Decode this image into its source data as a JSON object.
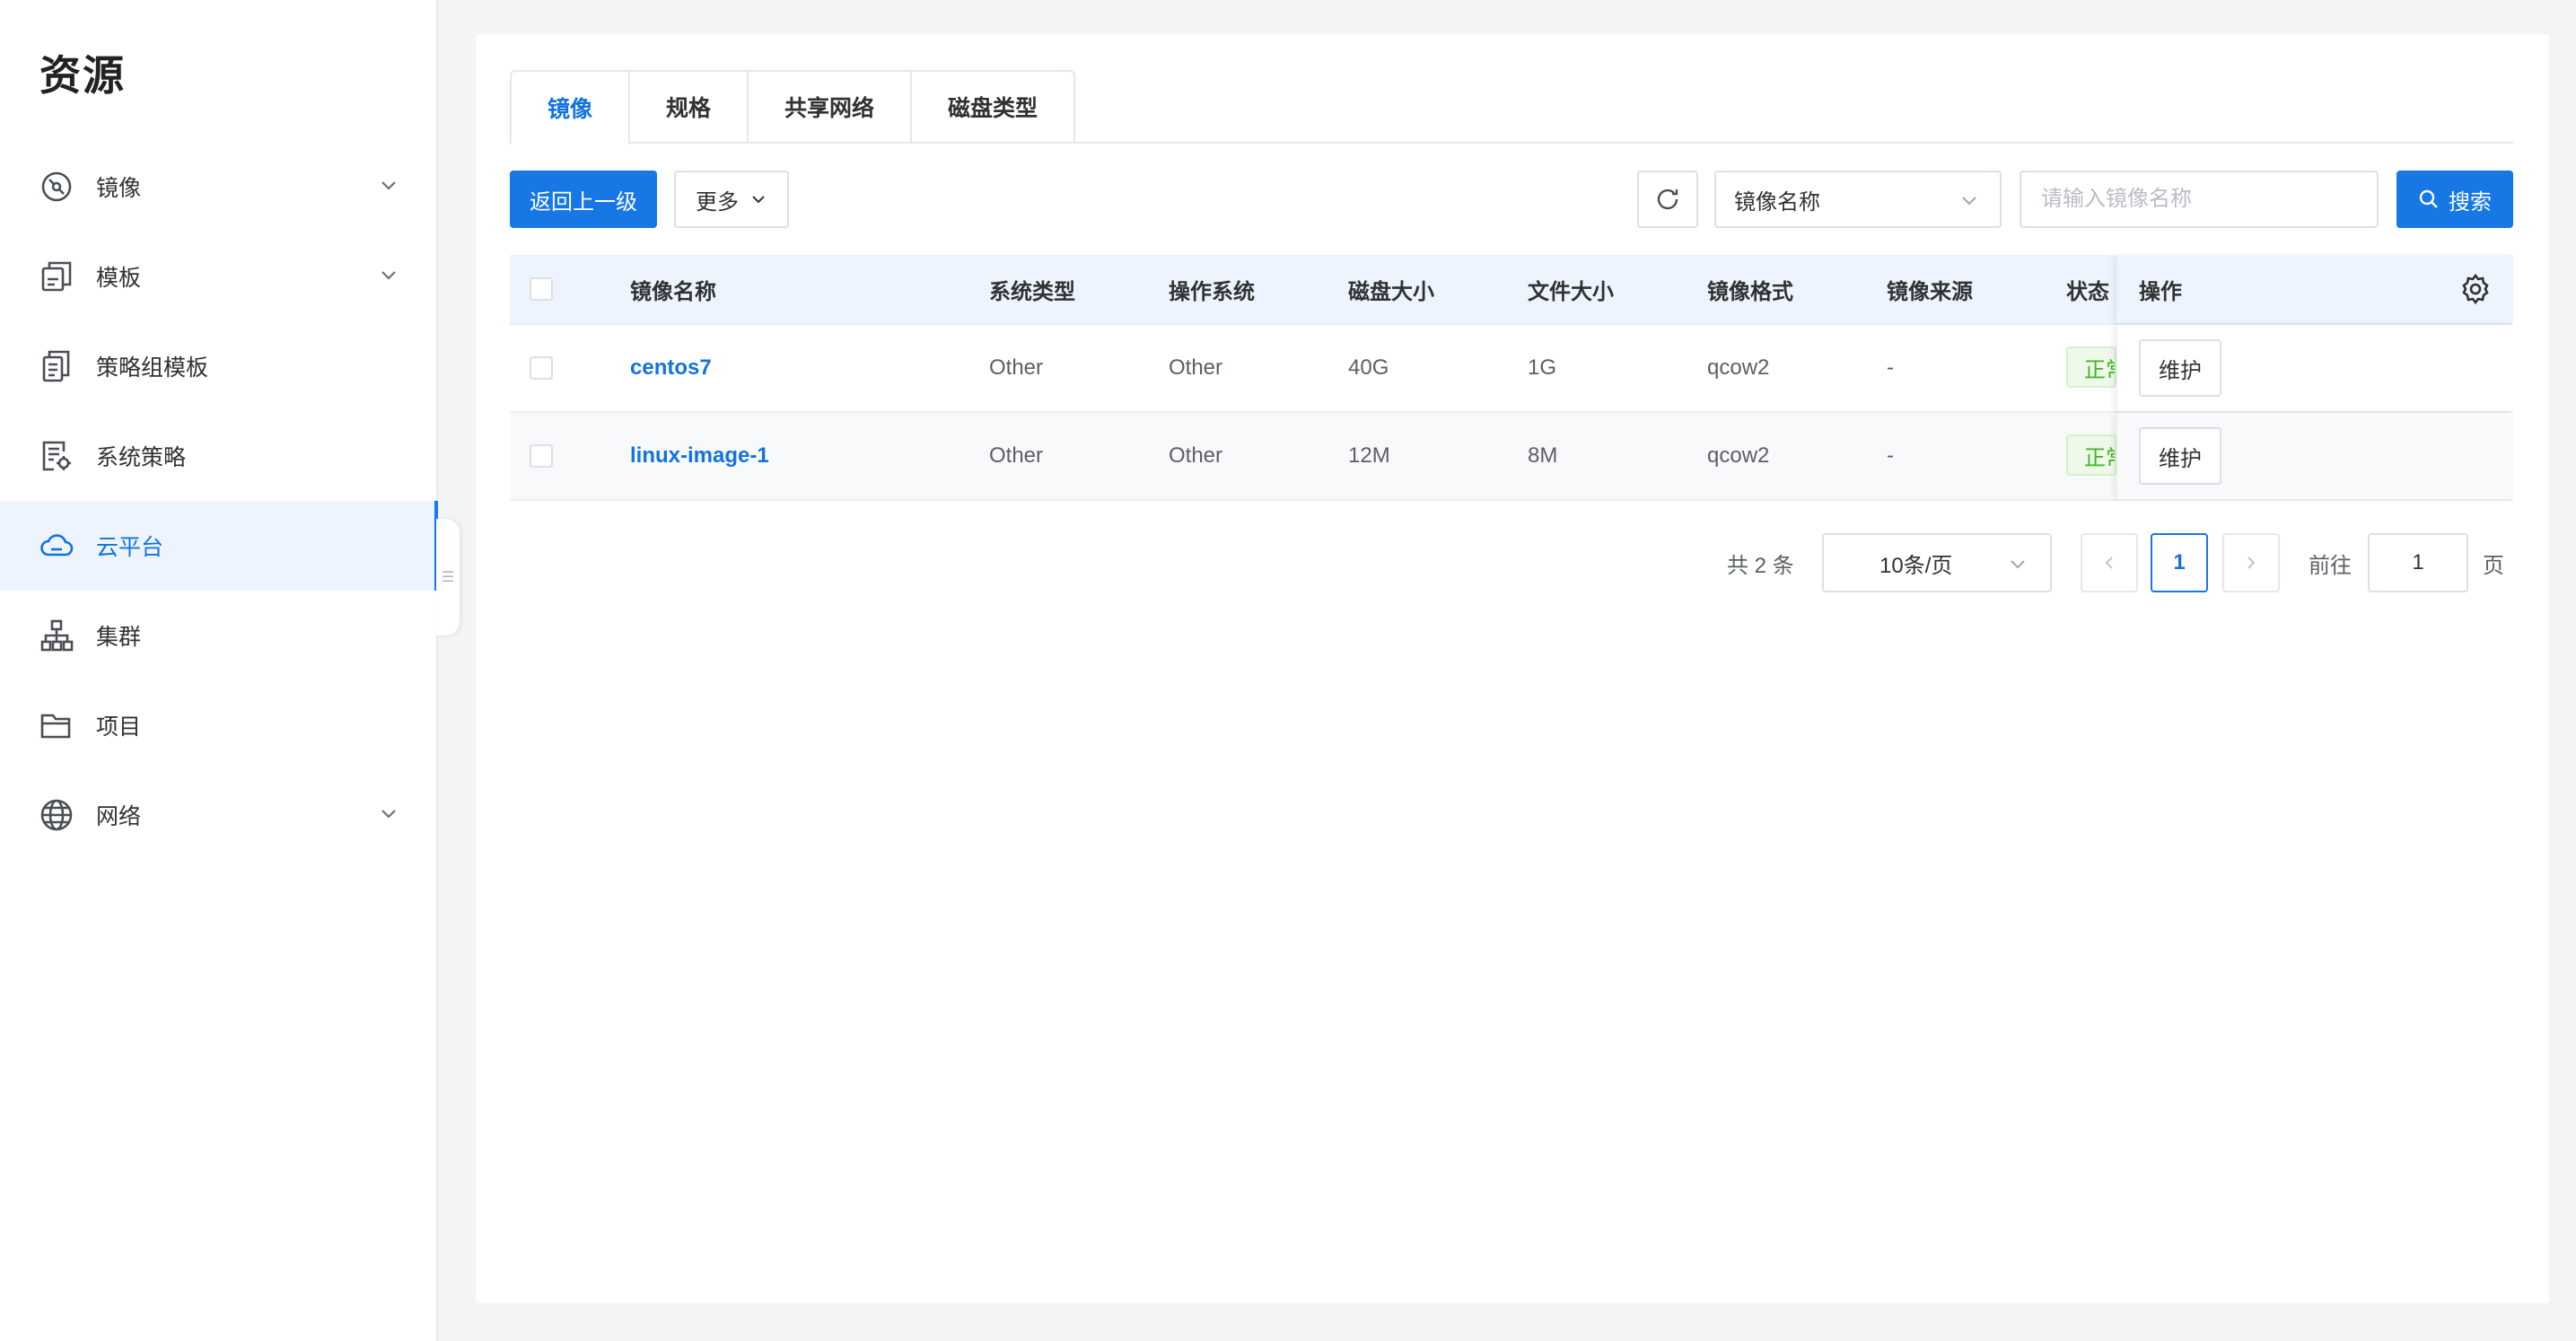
{
  "sidebar": {
    "title": "资源",
    "items": [
      {
        "label": "镜像",
        "icon": "disc-icon",
        "expandable": true,
        "active": false
      },
      {
        "label": "模板",
        "icon": "template-icon",
        "expandable": true,
        "active": false
      },
      {
        "label": "策略组模板",
        "icon": "document-copy-icon",
        "expandable": false,
        "active": false
      },
      {
        "label": "系统策略",
        "icon": "document-gear-icon",
        "expandable": false,
        "active": false
      },
      {
        "label": "云平台",
        "icon": "cloud-icon",
        "expandable": false,
        "active": true
      },
      {
        "label": "集群",
        "icon": "cluster-icon",
        "expandable": false,
        "active": false
      },
      {
        "label": "项目",
        "icon": "folder-icon",
        "expandable": false,
        "active": false
      },
      {
        "label": "网络",
        "icon": "globe-icon",
        "expandable": true,
        "active": false
      }
    ]
  },
  "tabs": [
    {
      "label": "镜像",
      "active": true
    },
    {
      "label": "规格",
      "active": false
    },
    {
      "label": "共享网络",
      "active": false
    },
    {
      "label": "磁盘类型",
      "active": false
    }
  ],
  "toolbar": {
    "back_label": "返回上一级",
    "more_label": "更多",
    "filter_select_value": "镜像名称",
    "search_placeholder": "请输入镜像名称",
    "search_label": "搜索"
  },
  "table": {
    "columns": [
      "镜像名称",
      "系统类型",
      "操作系统",
      "磁盘大小",
      "文件大小",
      "镜像格式",
      "镜像来源",
      "状态",
      "操作"
    ],
    "rows": [
      {
        "name": "centos7",
        "system_type": "Other",
        "os": "Other",
        "disk_size": "40G",
        "file_size": "1G",
        "format": "qcow2",
        "source": "-",
        "status": "正常",
        "action": "维护"
      },
      {
        "name": "linux-image-1",
        "system_type": "Other",
        "os": "Other",
        "disk_size": "12M",
        "file_size": "8M",
        "format": "qcow2",
        "source": "-",
        "status": "正常",
        "action": "维护"
      }
    ]
  },
  "pagination": {
    "total_label": "共 2 条",
    "page_size": "10条/页",
    "current_page": "1",
    "goto_label": "前往",
    "goto_value": "1",
    "page_unit": "页"
  },
  "colors": {
    "primary": "#1677e5",
    "active_text": "#1273e0",
    "status_success": "#42b224",
    "header_bg": "#edf4fd"
  }
}
